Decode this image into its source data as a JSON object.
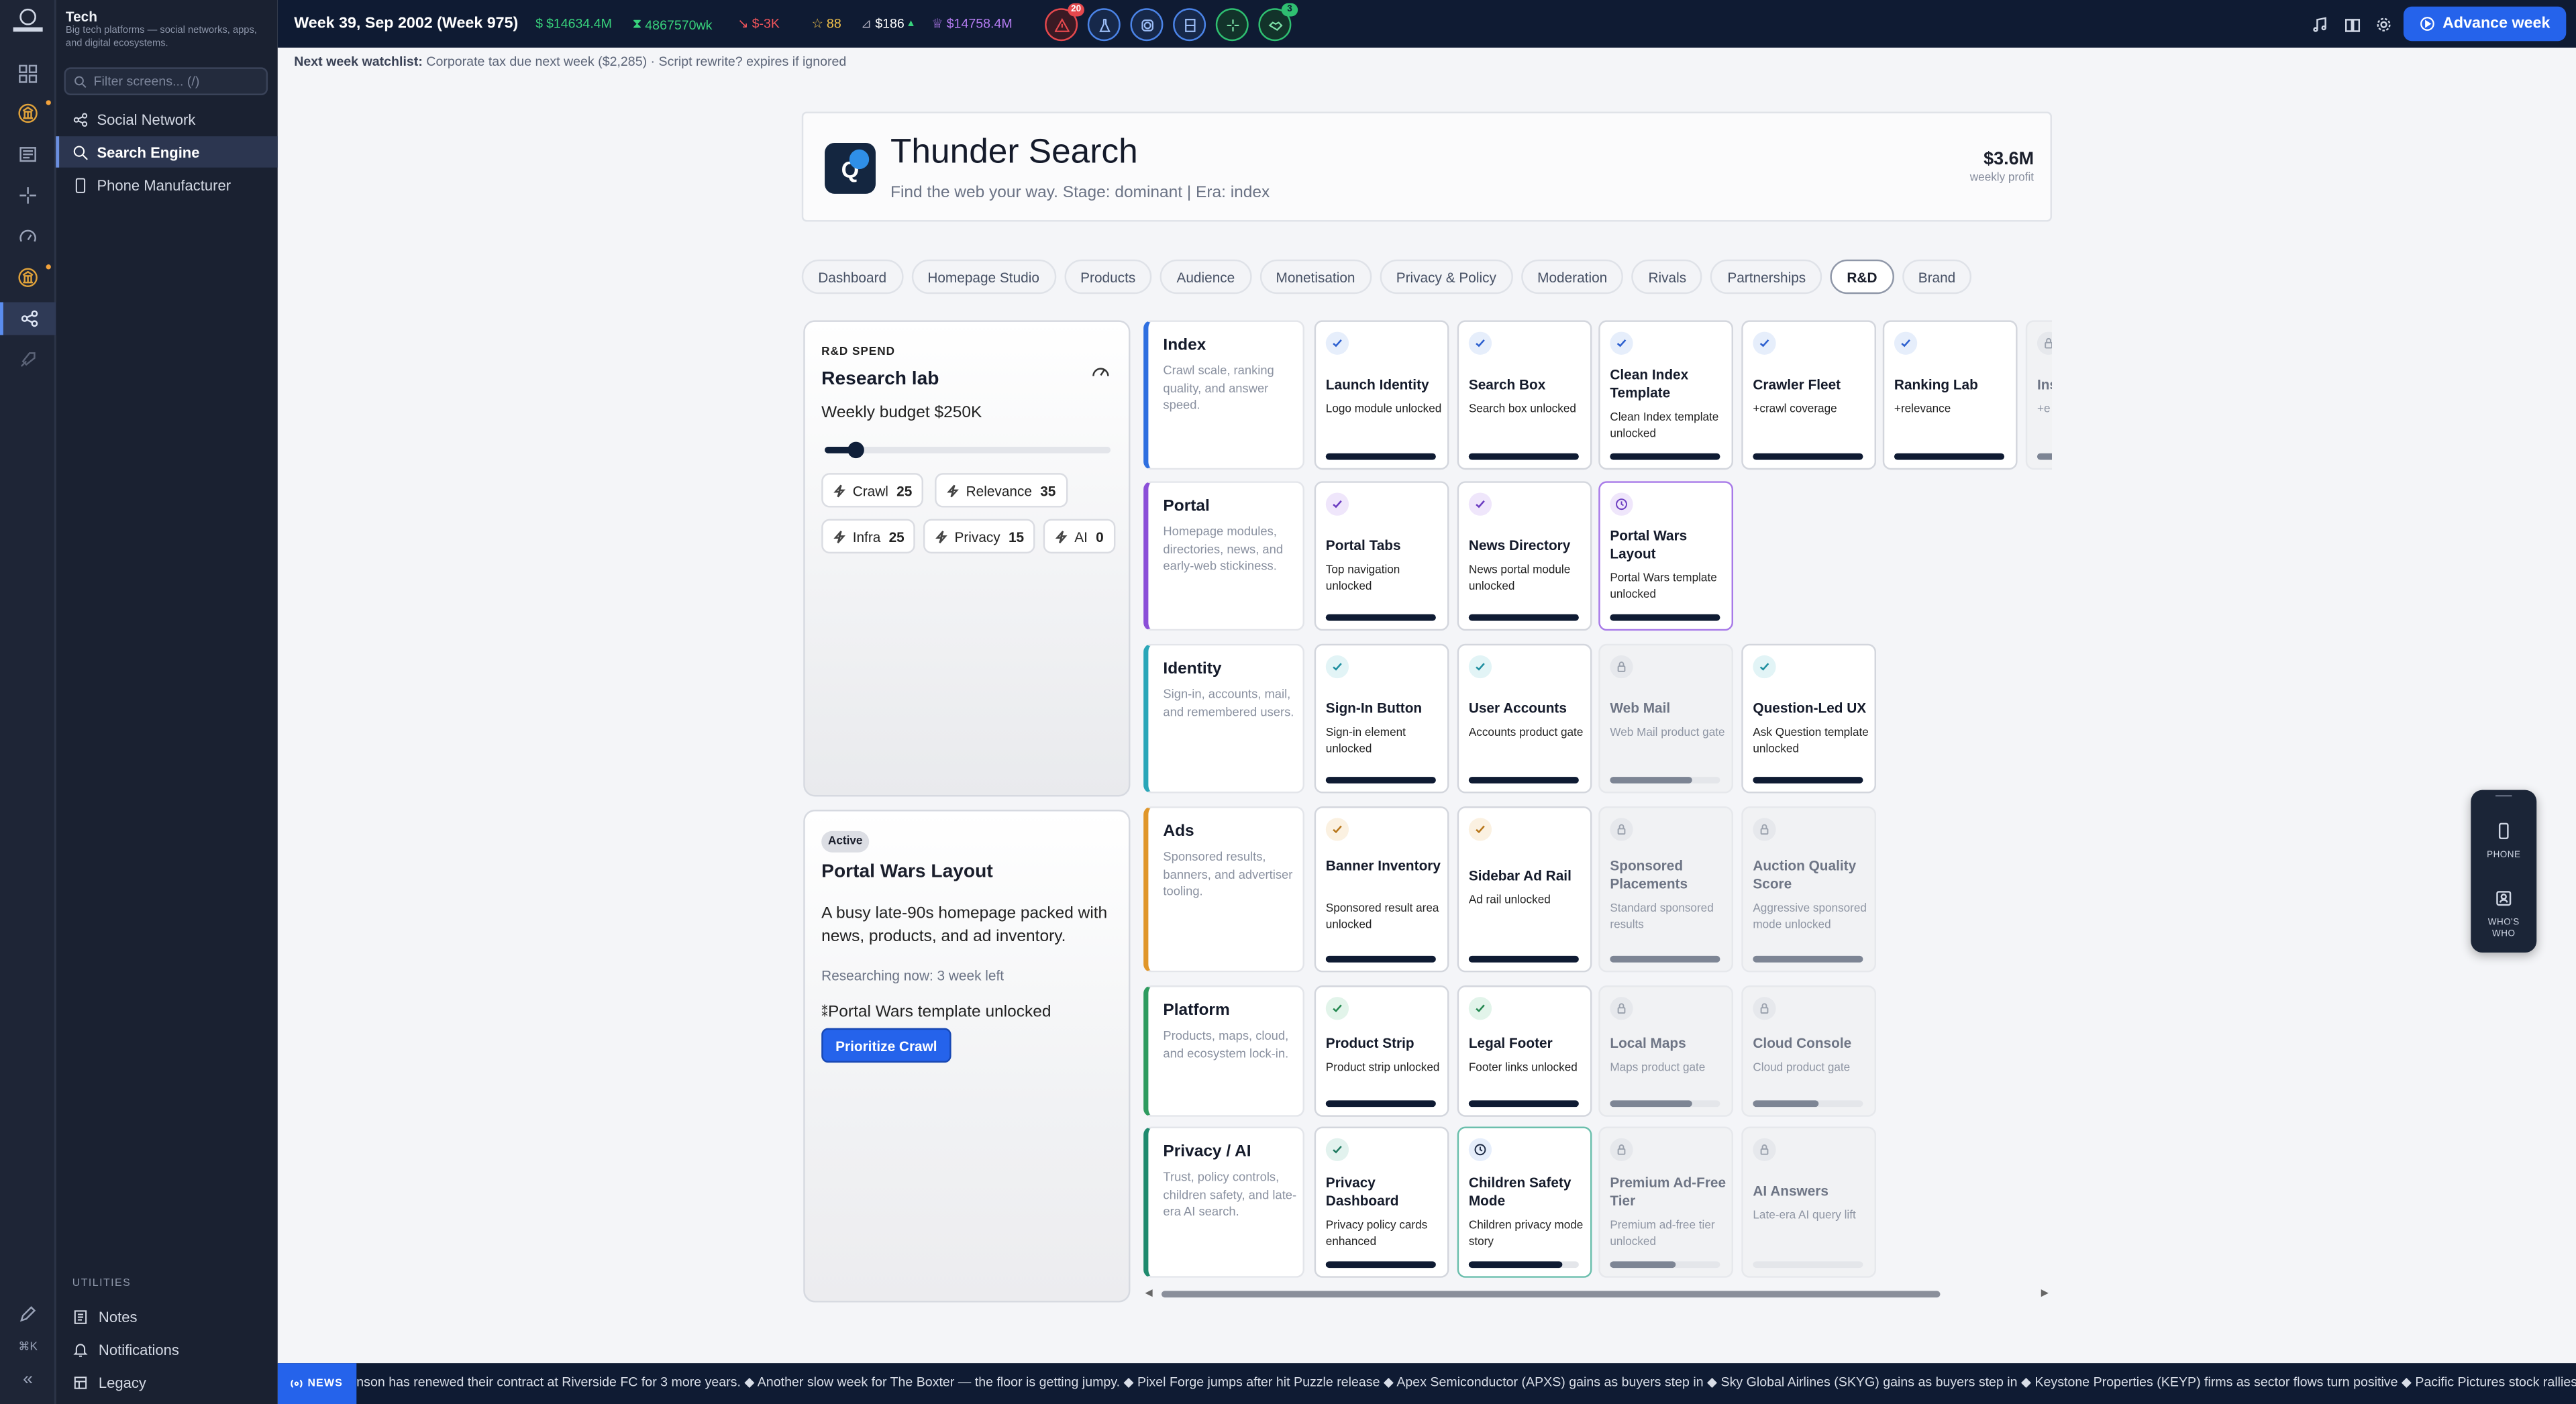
{
  "sidebar": {
    "title": "Tech",
    "subtitle": "Big tech platforms — social networks, apps, and digital ecosystems.",
    "filter_placeholder": "Filter screens... (/)",
    "items": [
      {
        "label": "Social Network",
        "icon": "share-icon"
      },
      {
        "label": "Search Engine",
        "icon": "search-icon",
        "selected": true
      },
      {
        "label": "Phone Manufacturer",
        "icon": "phone-icon"
      }
    ],
    "utilities_label": "UTILITIES",
    "utilities": [
      {
        "label": "Notes",
        "icon": "notes-icon"
      },
      {
        "label": "Notifications",
        "icon": "bell-icon"
      },
      {
        "label": "Legacy",
        "icon": "legacy-icon"
      }
    ],
    "shortcut_label": "⌘K",
    "collapse_label": "«"
  },
  "topbar": {
    "week": "Week 39, Sep 2002 (Week 975)",
    "cash": "$14634.4M",
    "income": "4867570wk",
    "delta": "$-3K",
    "reputation": "88",
    "stock": "$186",
    "net_worth": "$14758.4M",
    "alert_badge": "20",
    "green_badge": "3",
    "advance_label": "Advance week"
  },
  "watchlist": {
    "label": "Next week watchlist:",
    "text": "Corporate tax due next week ($2,285) · Script rewrite? expires if ignored"
  },
  "company": {
    "logo_letter": "Q",
    "name": "Thunder Search",
    "tagline": "Find the web your way. Stage: dominant | Era: index",
    "profit": "$3.6M",
    "profit_label": "weekly profit"
  },
  "tabs": [
    "Dashboard",
    "Homepage Studio",
    "Products",
    "Audience",
    "Monetisation",
    "Privacy & Policy",
    "Moderation",
    "Rivals",
    "Partnerships",
    "R&D",
    "Brand"
  ],
  "active_tab": "R&D",
  "rd": {
    "label": "R&D SPEND",
    "title": "Research lab",
    "budget": "Weekly budget $250K",
    "budget_level": 0.11,
    "chips": [
      {
        "label": "Crawl",
        "value": "25"
      },
      {
        "label": "Relevance",
        "value": "35"
      },
      {
        "label": "Infra",
        "value": "25"
      },
      {
        "label": "Privacy",
        "value": "15"
      },
      {
        "label": "AI",
        "value": "0"
      }
    ]
  },
  "active_project": {
    "badge": "Active",
    "title": "Portal Wars Layout",
    "desc": "A busy late-90s homepage packed with news, products, and ad inventory.",
    "researching": "Researching now: 3 week left",
    "unlock": "Portal Wars template unlocked",
    "button": "Prioritize Crawl"
  },
  "lanes": [
    {
      "title": "Index",
      "desc": "Crawl scale, ranking quality, and answer speed.",
      "color": "#2f6fe0",
      "cards": [
        {
          "title": "Launch Identity",
          "desc": "Logo module unlocked",
          "state": "done",
          "progress": 1
        },
        {
          "title": "Search Box",
          "desc": "Search box unlocked",
          "state": "done",
          "progress": 1
        },
        {
          "title": "Clean Index Template",
          "desc": "Clean Index template unlocked",
          "state": "done",
          "progress": 1
        },
        {
          "title": "Crawler Fleet",
          "desc": "+crawl coverage",
          "state": "done",
          "progress": 1
        },
        {
          "title": "Ranking Lab",
          "desc": "+relevance",
          "state": "done",
          "progress": 1
        },
        {
          "title": "Ins",
          "desc": "+e lat",
          "state": "locked",
          "progress": 0.3
        }
      ]
    },
    {
      "title": "Portal",
      "desc": "Homepage modules, directories, news, and early-web stickiness.",
      "color": "#8b4fd8",
      "cards": [
        {
          "title": "Portal Tabs",
          "desc": "Top navigation unlocked",
          "state": "done",
          "progress": 1
        },
        {
          "title": "News Directory",
          "desc": "News portal module unlocked",
          "state": "done",
          "progress": 1
        },
        {
          "title": "Portal Wars Layout",
          "desc": "Portal Wars template unlocked",
          "state": "active",
          "progress": 1
        }
      ]
    },
    {
      "title": "Identity",
      "desc": "Sign-in, accounts, mail, and remembered users.",
      "color": "#2aa6b8",
      "cards": [
        {
          "title": "Sign-In Button",
          "desc": "Sign-in element unlocked",
          "state": "done",
          "progress": 1
        },
        {
          "title": "User Accounts",
          "desc": "Accounts product gate",
          "state": "done",
          "progress": 1
        },
        {
          "title": "Web Mail",
          "desc": "Web Mail product gate",
          "state": "locked",
          "progress": 0.75
        },
        {
          "title": "Question-Led UX",
          "desc": "Ask Question template unlocked",
          "state": "done",
          "progress": 1
        }
      ]
    },
    {
      "title": "Ads",
      "desc": "Sponsored results, banners, and advertiser tooling.",
      "color": "#e0962a",
      "cards": [
        {
          "title": "Banner Inventory",
          "desc": "Sponsored result area unlocked",
          "state": "done",
          "progress": 1
        },
        {
          "title": "Sidebar Ad Rail",
          "desc": "Ad rail unlocked",
          "state": "done",
          "progress": 1
        },
        {
          "title": "Sponsored Placements",
          "desc": "Standard sponsored results",
          "state": "locked",
          "progress": 1
        },
        {
          "title": "Auction Quality Score",
          "desc": "Aggressive sponsored mode unlocked",
          "state": "locked",
          "progress": 1
        }
      ]
    },
    {
      "title": "Platform",
      "desc": "Products, maps, cloud, and ecosystem lock-in.",
      "color": "#2e9b5f",
      "cards": [
        {
          "title": "Product Strip",
          "desc": "Product strip unlocked",
          "state": "done",
          "progress": 1
        },
        {
          "title": "Legal Footer",
          "desc": "Footer links unlocked",
          "state": "done",
          "progress": 1
        },
        {
          "title": "Local Maps",
          "desc": "Maps product gate",
          "state": "locked",
          "progress": 0.75
        },
        {
          "title": "Cloud Console",
          "desc": "Cloud product gate",
          "state": "locked",
          "progress": 0.6
        }
      ]
    },
    {
      "title": "Privacy / AI",
      "desc": "Trust, policy controls, children safety, and late-era AI search.",
      "color": "#1f8a6e",
      "cards": [
        {
          "title": "Privacy Dashboard",
          "desc": "Privacy policy cards enhanced",
          "state": "done",
          "progress": 1
        },
        {
          "title": "Children Safety Mode",
          "desc": "Children privacy mode story",
          "state": "pending",
          "progress": 0.85
        },
        {
          "title": "Premium Ad-Free Tier",
          "desc": "Premium ad-free tier unlocked",
          "state": "locked",
          "progress": 0.6
        },
        {
          "title": "AI Answers",
          "desc": "Late-era AI query lift",
          "state": "locked",
          "progress": 0
        }
      ]
    }
  ],
  "float_panel": {
    "items": [
      {
        "label": "PHONE"
      },
      {
        "label": "WHO'S WHO"
      }
    ]
  },
  "news": {
    "label": "NEWS",
    "text": "nson has renewed their contract at Riverside FC for 3 more years. ◆ Another slow week for The Boxter — the floor is getting jumpy. ◆ Pixel Forge jumps after hit Puzzle release ◆ Apex Semiconductor (APXS) gains as buyers step in ◆ Sky Global Airlines (SKYG) gains as buyers step in ◆ Keystone Properties (KEYP) firms as sector flows turn positive ◆ Pacific Pictures stock rallies on b"
  }
}
